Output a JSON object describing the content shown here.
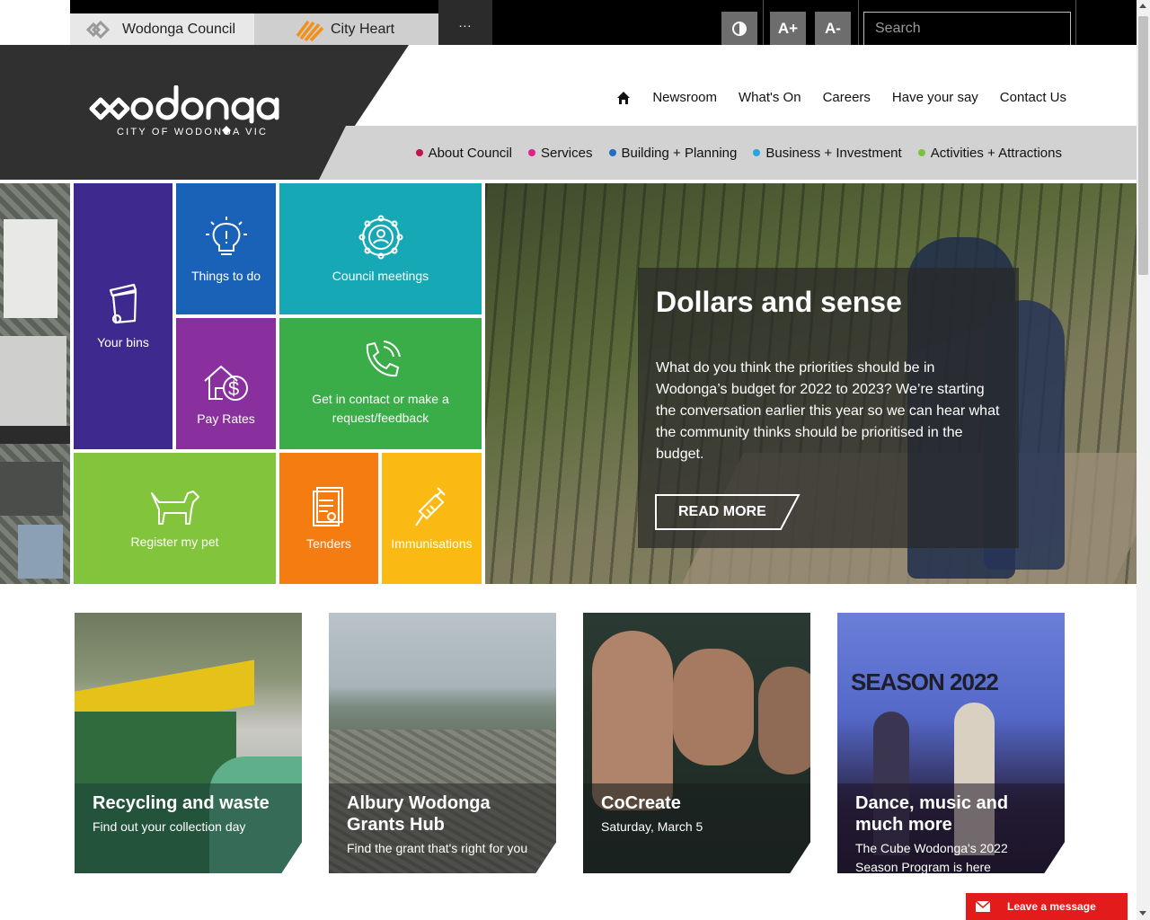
{
  "topbar": {
    "site_tabs": [
      {
        "label": "Wodonga Council",
        "icon": "wodonga-diamond-logo-icon"
      },
      {
        "label": "City Heart",
        "icon": "city-heart-logo-icon"
      }
    ],
    "more_label": "...",
    "contrast_icon": "contrast-icon",
    "font_increase_label": "A+",
    "font_decrease_label": "A-",
    "search_placeholder": "Search"
  },
  "header": {
    "logo_text": "wodonga",
    "logo_subtitle": "CITY OF WODONGA  VIC",
    "util_nav": [
      "Newsroom",
      "What's On",
      "Careers",
      "Have your say",
      "Contact Us"
    ],
    "main_nav": [
      {
        "label": "About Council",
        "color": "#c3124f"
      },
      {
        "label": "Services",
        "color": "#e0218a"
      },
      {
        "label": "Building + Planning",
        "color": "#1f6fc1"
      },
      {
        "label": "Business + Investment",
        "color": "#23a7e0"
      },
      {
        "label": "Activities + Attractions",
        "color": "#7cc242"
      }
    ]
  },
  "tiles": [
    {
      "key": "your_bins",
      "label": "Your bins",
      "color": "#3e2a8e",
      "icon": "bin-icon"
    },
    {
      "key": "things_to_do",
      "label": "Things to do",
      "color": "#1a62b8",
      "icon": "lightbulb-icon"
    },
    {
      "key": "council_meetings",
      "label": "Council meetings",
      "color": "#16a8b5",
      "icon": "meeting-people-icon"
    },
    {
      "key": "pay_rates",
      "label": "Pay Rates",
      "color": "#8a2f9e",
      "icon": "house-dollar-icon"
    },
    {
      "key": "contact",
      "label": "Get in contact or make a request/feedback",
      "color": "#3aac48",
      "icon": "phone-icon"
    },
    {
      "key": "register_pet",
      "label": "Register my pet",
      "color": "#82c43b",
      "icon": "dog-icon"
    },
    {
      "key": "tenders",
      "label": "Tenders",
      "color": "#f57c10",
      "icon": "document-icon"
    },
    {
      "key": "immunisations",
      "label": "Immunisations",
      "color": "#fbb914",
      "icon": "syringe-icon"
    }
  ],
  "hero": {
    "title": "Dollars and sense",
    "body": "What do you think the priorities should be in Wodonga’s budget for 2022 to 2023?  We’re starting the conversation earlier this year so we can hear what the community thinks should be prioritised in the budget.",
    "button": "READ MORE"
  },
  "cards": [
    {
      "title": "Recycling and waste",
      "subtitle": "Find out your collection day"
    },
    {
      "title": "Albury Wodonga Grants Hub",
      "subtitle": "Find the grant that's right for you"
    },
    {
      "title": "CoCreate",
      "subtitle": "Saturday, March 5"
    },
    {
      "title": "Dance, music and much more",
      "subtitle": "The Cube Wodonga's 2022 Season Program is here"
    }
  ],
  "chat": {
    "label": "Leave a message",
    "icon": "mail-icon"
  }
}
